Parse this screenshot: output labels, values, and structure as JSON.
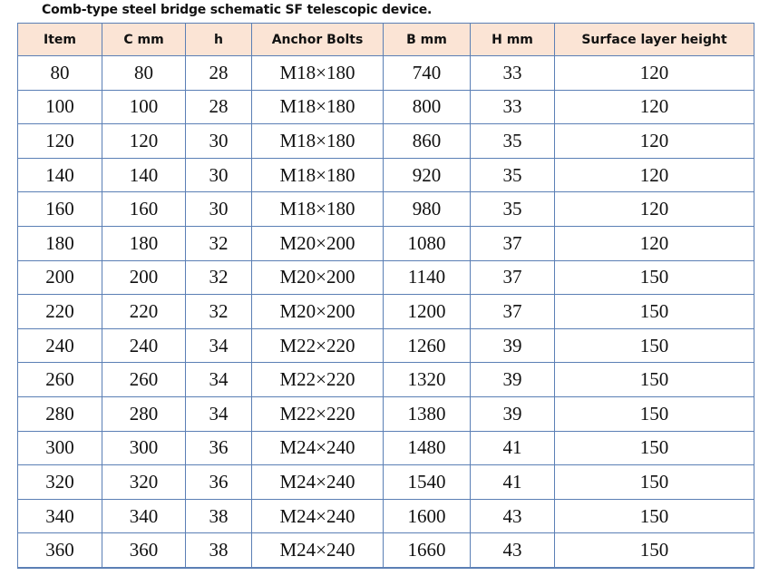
{
  "title": "Comb-type steel bridge schematic SF telescopic device.",
  "columns": [
    "Item",
    "C mm",
    "h",
    "Anchor Bolts",
    "B mm",
    "H mm",
    "Surface layer height"
  ],
  "rows": [
    [
      "80",
      "80",
      "28",
      "M18×180",
      "740",
      "33",
      "120"
    ],
    [
      "100",
      "100",
      "28",
      "M18×180",
      "800",
      "33",
      "120"
    ],
    [
      "120",
      "120",
      "30",
      "M18×180",
      "860",
      "35",
      "120"
    ],
    [
      "140",
      "140",
      "30",
      "M18×180",
      "920",
      "35",
      "120"
    ],
    [
      "160",
      "160",
      "30",
      "M18×180",
      "980",
      "35",
      "120"
    ],
    [
      "180",
      "180",
      "32",
      "M20×200",
      "1080",
      "37",
      "120"
    ],
    [
      "200",
      "200",
      "32",
      "M20×200",
      "1140",
      "37",
      "150"
    ],
    [
      "220",
      "220",
      "32",
      "M20×200",
      "1200",
      "37",
      "150"
    ],
    [
      "240",
      "240",
      "34",
      "M22×220",
      "1260",
      "39",
      "150"
    ],
    [
      "260",
      "260",
      "34",
      "M22×220",
      "1320",
      "39",
      "150"
    ],
    [
      "280",
      "280",
      "34",
      "M22×220",
      "1380",
      "39",
      "150"
    ],
    [
      "300",
      "300",
      "36",
      "M24×240",
      "1480",
      "41",
      "150"
    ],
    [
      "320",
      "320",
      "36",
      "M24×240",
      "1540",
      "41",
      "150"
    ],
    [
      "340",
      "340",
      "38",
      "M24×240",
      "1600",
      "43",
      "150"
    ],
    [
      "360",
      "360",
      "38",
      "M24×240",
      "1660",
      "43",
      "150"
    ]
  ]
}
